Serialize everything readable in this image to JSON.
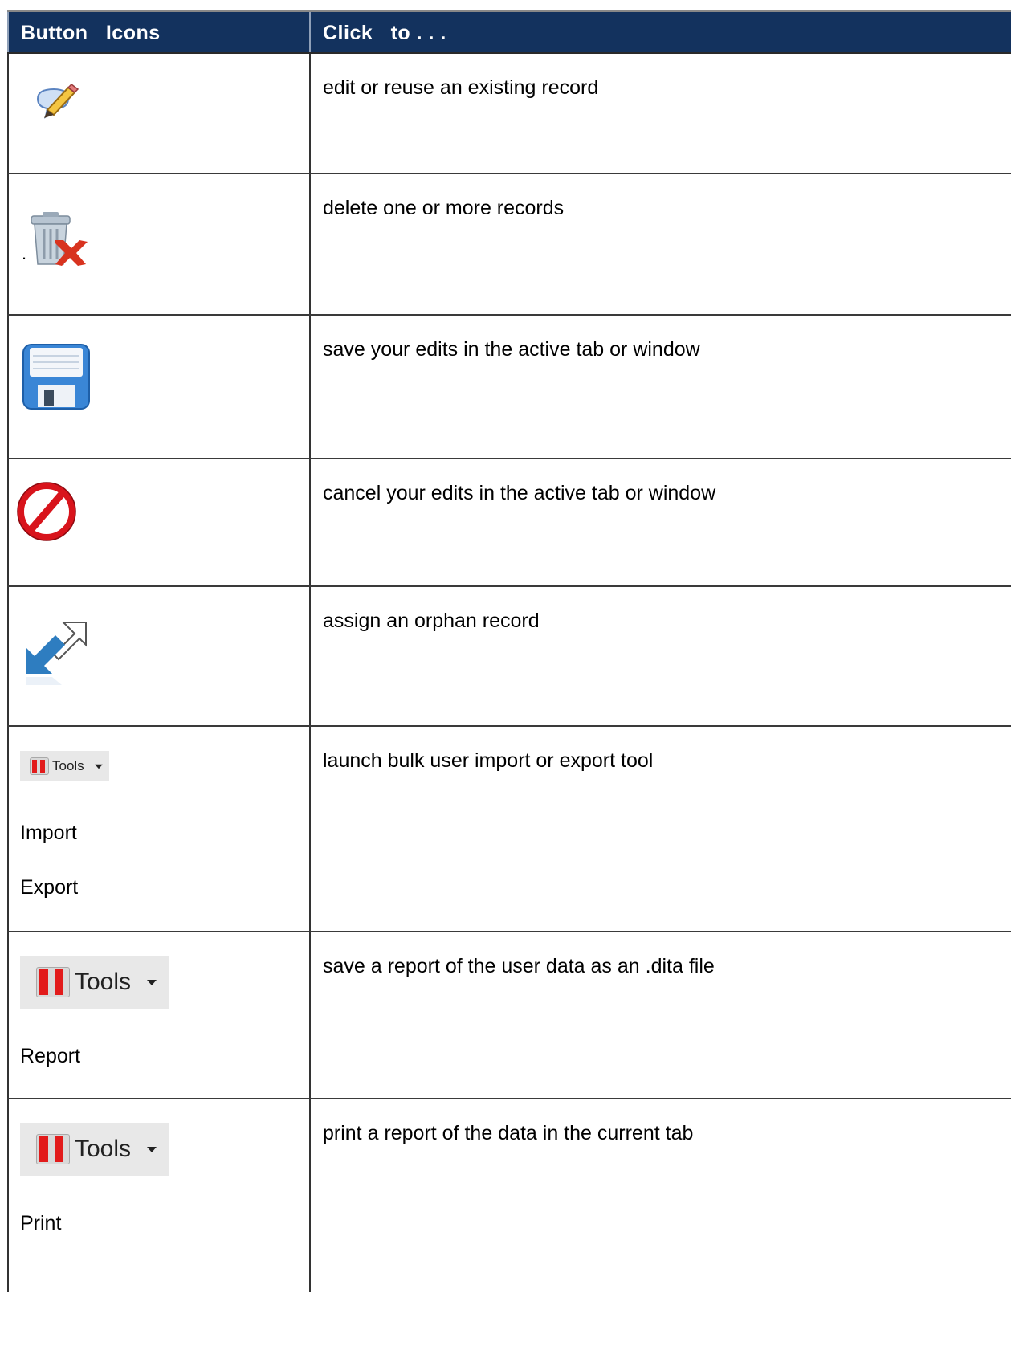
{
  "header": {
    "col1": "Button   Icons",
    "col2": "Click   to . . ."
  },
  "rows": [
    {
      "icon": "edit-pencil-icon",
      "desc": "edit or reuse an existing record"
    },
    {
      "icon": "trash-delete-icon",
      "desc": "delete one or more records",
      "dot": "."
    },
    {
      "icon": "floppy-save-icon",
      "desc": "save your edits in the active tab or window"
    },
    {
      "icon": "cancel-prohibited-icon",
      "desc": "cancel your edits in the active tab or window"
    },
    {
      "icon": "assign-arrows-icon",
      "desc": "assign an orphan record"
    },
    {
      "icon": "tools-menu-icon",
      "tools_label": "Tools",
      "desc": "launch bulk user import or export tool",
      "labels": [
        "Import",
        "Export"
      ]
    },
    {
      "icon": "tools-menu-icon",
      "tools_label": "Tools",
      "desc": "save a report of the user data as an .dita file",
      "labels": [
        "Report"
      ]
    },
    {
      "icon": "tools-menu-icon",
      "tools_label": "Tools",
      "desc": "print a report of the data in the current tab",
      "labels": [
        "Print"
      ]
    }
  ],
  "colors": {
    "header_bg": "#13325e",
    "header_text": "#ffffff",
    "border": "#3a3a3a"
  }
}
